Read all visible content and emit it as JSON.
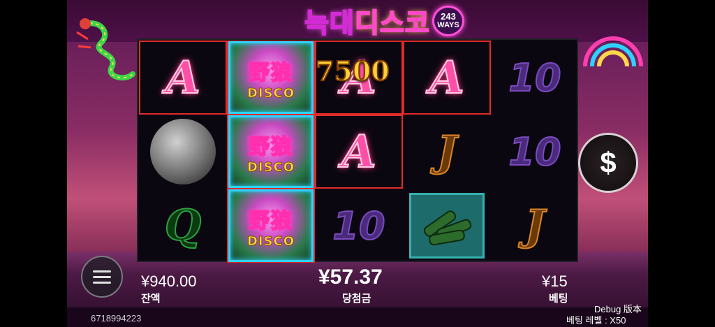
{
  "game": {
    "title_part1": "늑대",
    "title_part2": "디스코",
    "ways_number": "243",
    "ways_label": "WAYS"
  },
  "reels": [
    [
      {
        "symbol": "A",
        "kind": "letter-a",
        "highlight": true
      },
      {
        "symbol": "disco-ball",
        "kind": "ball",
        "highlight": false
      },
      {
        "symbol": "Q",
        "kind": "letter-q",
        "highlight": false
      }
    ],
    [
      {
        "symbol": "野狼",
        "sub": "DISCO",
        "kind": "wild",
        "highlight": true
      },
      {
        "symbol": "野狼",
        "sub": "DISCO",
        "kind": "wild",
        "highlight": true
      },
      {
        "symbol": "野狼",
        "sub": "DISCO",
        "kind": "wild",
        "highlight": true
      }
    ],
    [
      {
        "symbol": "A",
        "kind": "letter-a",
        "highlight": true
      },
      {
        "symbol": "A",
        "kind": "letter-a",
        "highlight": true
      },
      {
        "symbol": "10",
        "kind": "ten",
        "highlight": false
      }
    ],
    [
      {
        "symbol": "A",
        "kind": "letter-a",
        "highlight": true
      },
      {
        "symbol": "J",
        "kind": "letter-j",
        "highlight": false
      },
      {
        "symbol": "bottles",
        "kind": "bottles",
        "highlight": false
      }
    ],
    [
      {
        "symbol": "10",
        "kind": "ten",
        "highlight": false
      },
      {
        "symbol": "10",
        "kind": "ten",
        "highlight": false
      },
      {
        "symbol": "J",
        "kind": "letter-j",
        "highlight": false
      }
    ]
  ],
  "win_overlay": "7500",
  "balance": {
    "value": "¥940.00",
    "label": "잔액"
  },
  "win": {
    "value": "¥57.37",
    "label": "당첨금"
  },
  "bet": {
    "value": "¥15",
    "label": "베팅"
  },
  "session_id": "6718994223",
  "debug_label": "Debug 版本",
  "bet_level_label": "베팅 레벨 : X50",
  "icons": {
    "spin": "dollar-icon",
    "menu": "menu-icon"
  },
  "colors": {
    "highlight": "#e02b2b",
    "wild_border": "#2ed2ff",
    "accent_pink": "#ff4fa6"
  }
}
